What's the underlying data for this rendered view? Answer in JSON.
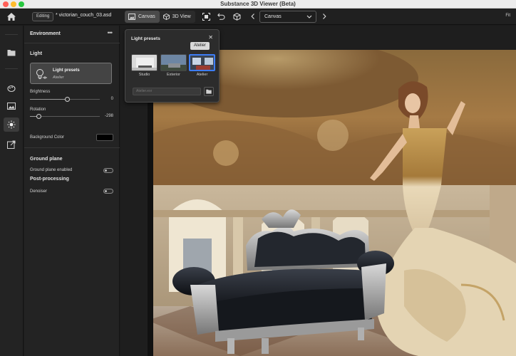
{
  "window": {
    "title": "Substance 3D Viewer (Beta)"
  },
  "toolbar": {
    "editing_badge": "Editing",
    "filename": "* victorian_couch_03.asd",
    "canvas_tab": "Canvas",
    "view3d_tab": "3D View",
    "canvas_select": "Canvas",
    "fit_label": "Fit"
  },
  "panel": {
    "title": "Environment",
    "more": "•••",
    "light_section": "Light",
    "light_presets_title": "Light presets",
    "light_presets_value": "Atelier",
    "brightness_label": "Brightness",
    "brightness_value": "0",
    "rotation_label": "Rotation",
    "rotation_value": "-298",
    "background_color_label": "Background Color",
    "background_color": "#000000",
    "ground_section": "Ground plane",
    "ground_enabled_label": "Ground plane enabled",
    "post_section": "Post-processing",
    "denoiser_label": "Denoiser"
  },
  "popover": {
    "title": "Light presets",
    "close": "✕",
    "presets": [
      {
        "label": "Studio"
      },
      {
        "label": "Exterior"
      },
      {
        "label": "Atelier"
      }
    ],
    "tooltip": "Atelier",
    "search_placeholder": "Atelier.exr"
  },
  "icons": {
    "home": "home-icon",
    "fit": "fit-frame-icon",
    "undo": "undo-icon",
    "cube": "cube-icon",
    "prev": "chevron-left-icon",
    "next": "chevron-right-icon"
  },
  "colors": {
    "accent": "#3d7df5",
    "panel_bg": "#232323",
    "toolbar_bg": "#202020"
  }
}
